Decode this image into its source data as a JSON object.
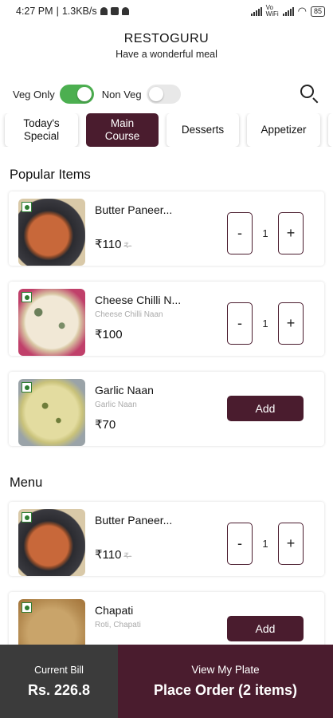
{
  "status_bar": {
    "time": "4:27 PM",
    "network_speed": "1.3KB/s",
    "network_label": "Vo WiFi",
    "battery": "85"
  },
  "header": {
    "title": "RESTOGURU",
    "subtitle": "Have a wonderful meal"
  },
  "filters": {
    "veg_only_label": "Veg Only",
    "veg_only_on": true,
    "non_veg_label": "Non Veg",
    "non_veg_on": false
  },
  "tabs": [
    {
      "label": "Today's\nSpecial",
      "active": false
    },
    {
      "label": "Main\nCourse",
      "active": true
    },
    {
      "label": "Desserts",
      "active": false
    },
    {
      "label": "Appetizer",
      "active": false
    }
  ],
  "popular": {
    "title": "Popular Items",
    "items": [
      {
        "name": "Butter Paneer...",
        "desc": "",
        "price": "₹110",
        "strike_price": "₹-",
        "qty": "1",
        "minus": "-",
        "plus": "+"
      },
      {
        "name": "Cheese Chilli N...",
        "desc": "Cheese Chilli Naan",
        "price": "₹100",
        "qty": "1",
        "minus": "-",
        "plus": "+"
      },
      {
        "name": "Garlic Naan",
        "desc": "Garlic Naan",
        "price": "₹70",
        "add_label": "Add"
      }
    ]
  },
  "menu": {
    "title": "Menu",
    "items": [
      {
        "name": "Butter Paneer...",
        "price": "₹110",
        "strike_price": "₹-",
        "qty": "1",
        "minus": "-",
        "plus": "+"
      },
      {
        "name": "Chapati",
        "desc": "Roti, Chapati",
        "add_label": "Add"
      }
    ]
  },
  "bottom_bar": {
    "bill_label": "Current Bill",
    "bill_amount": "Rs. 226.8",
    "plate_label": "View My Plate",
    "place_order": "Place Order (2 items)"
  },
  "colors": {
    "brand": "#4a1c2e",
    "toggle_on": "#4caf50",
    "bill_bg": "#3b3b3b",
    "veg_green": "#2e7d32"
  }
}
